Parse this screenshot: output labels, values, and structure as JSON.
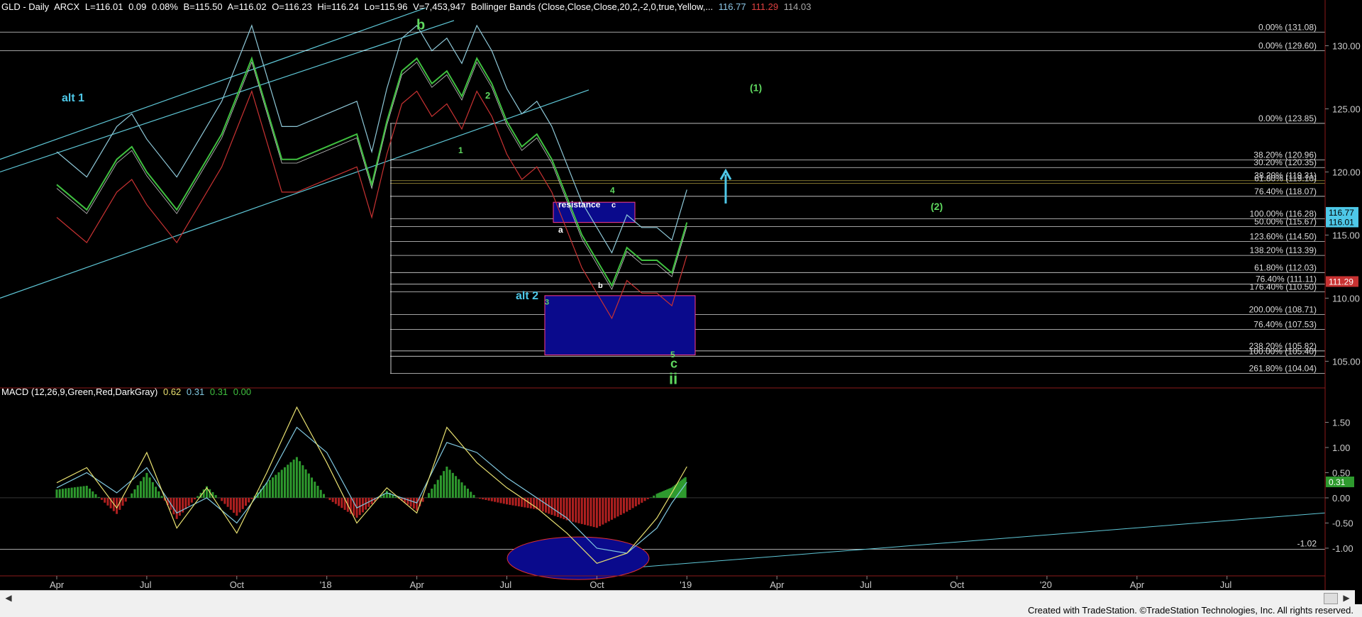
{
  "header": {
    "symbol": "GLD - Daily",
    "exchange": "ARCX",
    "last": "L=116.01",
    "change": "0.09",
    "pct": "0.08%",
    "bid": "B=115.50",
    "ask": "A=116.02",
    "open": "O=116.23",
    "high": "Hi=116.24",
    "low": "Lo=115.96",
    "volume": "V=7,453,947",
    "indicator": "Bollinger Bands (Close,Close,Close,20,2,-2,0,true,Yellow,...",
    "bb_upper": "116.77",
    "bb_lower": "111.29",
    "bb_mid": "114.03"
  },
  "macd_header": {
    "label": "MACD (12,26,9,Green,Red,DarkGray)",
    "v1": "0.62",
    "v2": "0.31",
    "v3": "0.31",
    "v4": "0.00"
  },
  "footer": "Created with TradeStation. ©TradeStation Technologies, Inc. All rights reserved.",
  "colors": {
    "price": "#3fc03f",
    "bb_upper": "#8ec8d8",
    "bb_lower": "#c83232",
    "bb_mid": "#c8c8c8",
    "channel": "#5fc8d8",
    "fib": "#ffffff",
    "box": "#0a0a8c",
    "box_border": "#ff3c8c",
    "macd_pos": "#2e9a2e",
    "macd_neg": "#b02020",
    "macd_line": "#e8e070",
    "signal_line": "#80c8e0",
    "green_label": "#5fd85f",
    "cyan_label": "#4ec8e8"
  },
  "chart_data": [
    {
      "type": "line",
      "title": "GLD - Daily",
      "xlabel": "",
      "ylabel": "",
      "x_ticks": [
        "Apr",
        "Jul",
        "Oct",
        "'18",
        "Apr",
        "Jul",
        "Oct",
        "'19",
        "Apr",
        "Jul",
        "Oct",
        "'20",
        "Apr",
        "Jul"
      ],
      "y_ticks": [
        105.0,
        110.0,
        115.0,
        120.0,
        125.0,
        130.0
      ],
      "ylim": [
        103,
        132.5
      ],
      "series": [
        {
          "name": "",
          "x_month_index": [
            0,
            1,
            2,
            2.5,
            3,
            4,
            5,
            5.5,
            6,
            6.5,
            7,
            7.5,
            8,
            9,
            10,
            10.5,
            11,
            11.5,
            12,
            12.5,
            13,
            13.5,
            14,
            14.5,
            15,
            15.5,
            16,
            16.5,
            17,
            17.5,
            18,
            18.5,
            19,
            19.5,
            20,
            20.5,
            21
          ],
          "values": [
            119,
            117,
            121,
            122,
            120,
            117,
            121,
            123,
            126,
            129,
            125,
            121,
            121,
            122,
            123,
            119,
            124,
            128,
            129,
            127,
            128,
            126,
            129,
            127,
            124,
            122,
            123,
            121,
            118,
            115,
            113,
            111,
            114,
            113,
            113,
            112,
            116
          ]
        }
      ],
      "bollinger_last": {
        "upper": 116.77,
        "lower": 111.29,
        "mid": 114.03
      },
      "fib_levels": [
        {
          "label": "0.00% (131.08)",
          "value": 131.08
        },
        {
          "label": "0.00% (129.60)",
          "value": 129.6
        },
        {
          "label": "0.00% (123.85)",
          "value": 123.85
        },
        {
          "label": "38.20% (120.96)",
          "value": 120.96
        },
        {
          "label": "30.20% (120.35)",
          "value": 120.35
        },
        {
          "label": "38.20% (119.31)",
          "value": 119.31
        },
        {
          "label": "61.80% (119.10)",
          "value": 119.1
        },
        {
          "label": "76.40% (118.07)",
          "value": 118.07
        },
        {
          "label": "100.00% (116.28)",
          "value": 116.28
        },
        {
          "label": "50.00% (115.67)",
          "value": 115.67
        },
        {
          "label": "123.60% (114.50)",
          "value": 114.5
        },
        {
          "label": "138.20% (113.39)",
          "value": 113.39
        },
        {
          "label": "61.80% (112.03)",
          "value": 112.03
        },
        {
          "label": "76.40% (111.11)",
          "value": 111.11
        },
        {
          "label": "176.40% (110.50)",
          "value": 110.5
        },
        {
          "label": "200.00% (108.71)",
          "value": 108.71
        },
        {
          "label": "76.40% (107.53)",
          "value": 107.53
        },
        {
          "label": "238.20% (105.82)",
          "value": 105.82
        },
        {
          "label": "100.00% (105.40)",
          "value": 105.4
        },
        {
          "label": "261.80% (104.04)",
          "value": 104.04
        }
      ],
      "price_tags": [
        "116.77",
        "116.01",
        "111.29"
      ],
      "annotations": [
        "b",
        "alt 1",
        "2",
        "(1)",
        "1",
        "4",
        "c",
        "resistance",
        "(2)",
        "a",
        "b",
        "alt 2",
        "3",
        "5",
        "c",
        "ii"
      ]
    },
    {
      "type": "line",
      "title": "MACD (12,26,9,Green,Red,DarkGray)",
      "y_ticks": [
        1.5,
        1.0,
        0.5,
        0.0,
        -0.5,
        -1.0
      ],
      "ylim": [
        -1.55,
        2.0
      ],
      "level_label": "-1.02",
      "last_value_tag": "0.31",
      "series": [
        {
          "name": "MACD",
          "x_month_index": [
            0,
            1,
            2,
            3,
            4,
            5,
            6,
            7,
            8,
            9,
            10,
            11,
            12,
            13,
            14,
            15,
            16,
            17,
            18,
            19,
            20,
            20.5,
            21
          ],
          "values": [
            0.3,
            0.6,
            -0.2,
            0.9,
            -0.6,
            0.2,
            -0.7,
            0.5,
            1.8,
            0.7,
            -0.5,
            0.2,
            -0.3,
            1.4,
            0.7,
            0.2,
            -0.2,
            -0.7,
            -1.3,
            -1.1,
            -0.4,
            0.1,
            0.62
          ]
        },
        {
          "name": "Signal",
          "x_month_index": [
            0,
            1,
            2,
            3,
            4,
            5,
            6,
            7,
            8,
            9,
            10,
            11,
            12,
            13,
            14,
            15,
            16,
            17,
            18,
            19,
            20,
            20.5,
            21
          ],
          "values": [
            0.2,
            0.5,
            0.1,
            0.6,
            -0.3,
            0.0,
            -0.5,
            0.3,
            1.4,
            0.9,
            -0.2,
            0.1,
            -0.1,
            1.1,
            0.9,
            0.4,
            0.0,
            -0.4,
            -1.0,
            -1.1,
            -0.6,
            -0.1,
            0.31
          ]
        }
      ]
    }
  ]
}
